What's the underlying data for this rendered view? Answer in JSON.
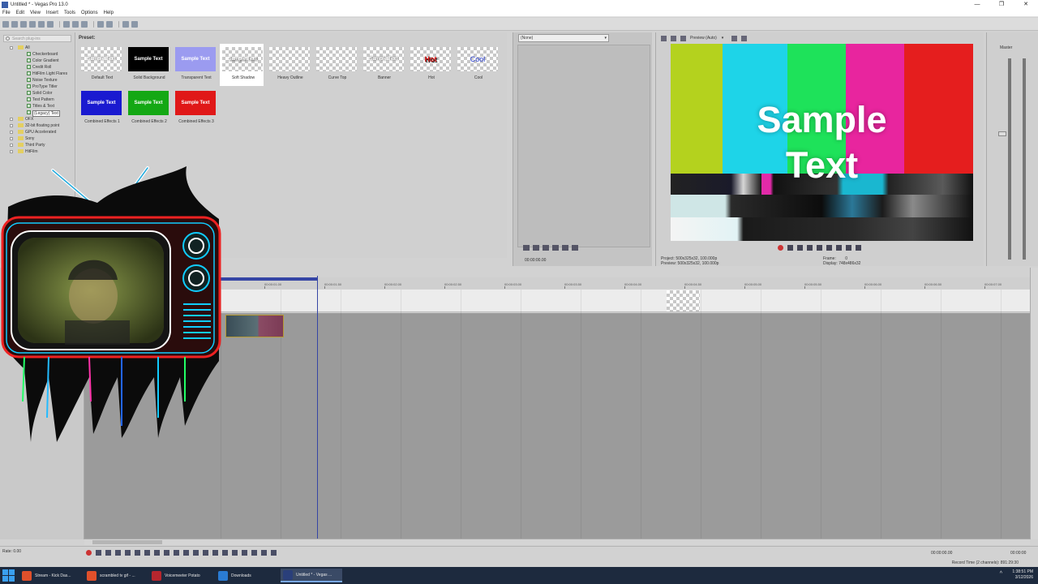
{
  "window": {
    "title": "Untitled * - Vegas Pro 13.0",
    "controls": [
      "—",
      "❐",
      "✕"
    ]
  },
  "menu": [
    "File",
    "Edit",
    "View",
    "Insert",
    "Tools",
    "Options",
    "Help"
  ],
  "plugin_tree": {
    "search_placeholder": "Search plug-ins",
    "items": [
      {
        "label": "All",
        "level": 0
      },
      {
        "label": "Checkerboard",
        "level": 1
      },
      {
        "label": "Color Gradient",
        "level": 1
      },
      {
        "label": "Credit Roll",
        "level": 1
      },
      {
        "label": "HitFilm Light Flares",
        "level": 1
      },
      {
        "label": "Noise Texture",
        "level": 1
      },
      {
        "label": "ProType Titler",
        "level": 1
      },
      {
        "label": "Solid Color",
        "level": 1
      },
      {
        "label": "Test Pattern",
        "level": 1
      },
      {
        "label": "Titles & Text",
        "level": 1
      },
      {
        "label": "(Legacy) Text",
        "level": 1,
        "selected": true
      },
      {
        "label": "OFX",
        "level": 0
      },
      {
        "label": "32-bit floating point",
        "level": 0
      },
      {
        "label": "GPU Accelerated",
        "level": 0
      },
      {
        "label": "Sony",
        "level": 0
      },
      {
        "label": "Third Party",
        "level": 0
      },
      {
        "label": "HitFilm",
        "level": 0
      }
    ]
  },
  "presets": {
    "header": "Preset:",
    "items": [
      {
        "label": "Default Text",
        "thumb_text": "Sample Text",
        "style": "default"
      },
      {
        "label": "Solid Background",
        "thumb_text": "Sample Text",
        "style": "solid"
      },
      {
        "label": "Transparent Text",
        "thumb_text": "Sample Text",
        "style": "transparent"
      },
      {
        "label": "Soft Shadow",
        "thumb_text": "Sample Text",
        "style": "soft",
        "selected": true
      },
      {
        "label": "Heavy Outline",
        "thumb_text": "",
        "style": "outline"
      },
      {
        "label": "Curve Top",
        "thumb_text": "",
        "style": "curve"
      },
      {
        "label": "Banner",
        "thumb_text": "Sample Text",
        "style": "banner"
      },
      {
        "label": "Hot",
        "thumb_text": "Hot",
        "style": "hot"
      },
      {
        "label": "Cool",
        "thumb_text": "Cool",
        "style": "cool"
      },
      {
        "label": "Combined Effects 1",
        "thumb_text": "Sample Text",
        "style": "c1"
      },
      {
        "label": "Combined Effects 2",
        "thumb_text": "Sample Text",
        "style": "c2"
      },
      {
        "label": "Combined Effects 3",
        "thumb_text": "Sample Text",
        "style": "c3"
      }
    ]
  },
  "trimmer": {
    "dropdown_value": "(None)",
    "timecode": "00:00:00.00"
  },
  "preview": {
    "mode_label": "Preview (Auto)",
    "overlay_text_line1": "Sample",
    "overlay_text_line2": "Text",
    "project_info": "Project:  500x325x32, 100.000p",
    "preview_info": "Preview:  500x325x32, 100.000p",
    "frame_label": "Frame:",
    "frame_value": "0",
    "display_label": "Display:",
    "display_value": "748x486x32"
  },
  "master": {
    "label": "Master"
  },
  "timeline": {
    "ruler_marks": [
      "00:00:01.00",
      "00:00:01.50",
      "00:00:02.00",
      "00:00:02.50",
      "00:00:03.00",
      "00:00:03.50",
      "00:00:04.00",
      "00:00:04.50",
      "00:00:05.00",
      "00:00:05.50",
      "00:00:06.00",
      "00:00:06.50",
      "00:00:07.00",
      "00:00:07.50"
    ],
    "loop_label": "00:00:00.00"
  },
  "transport": {
    "rate": "Rate: 0.00",
    "timecode": "00:00:00.00",
    "end_time": "00:00:00"
  },
  "status": {
    "record_time": "Record Time (2 channels): 891:29:30"
  },
  "taskbar": {
    "items": [
      {
        "label": "Stream - Kick Das...",
        "color": "#e0502b"
      },
      {
        "label": "scrambled tv gif - ...",
        "color": "#e0502b"
      },
      {
        "label": "Voicemeeter Potato",
        "color": "#b5262e"
      },
      {
        "label": "Downloads",
        "color": "#2a7bd3"
      },
      {
        "label": "Untitled * - Vegas ...",
        "color": "#2a3f7a",
        "active": true
      }
    ],
    "time": "1:38:51 PM",
    "date": "3/12/2026"
  }
}
